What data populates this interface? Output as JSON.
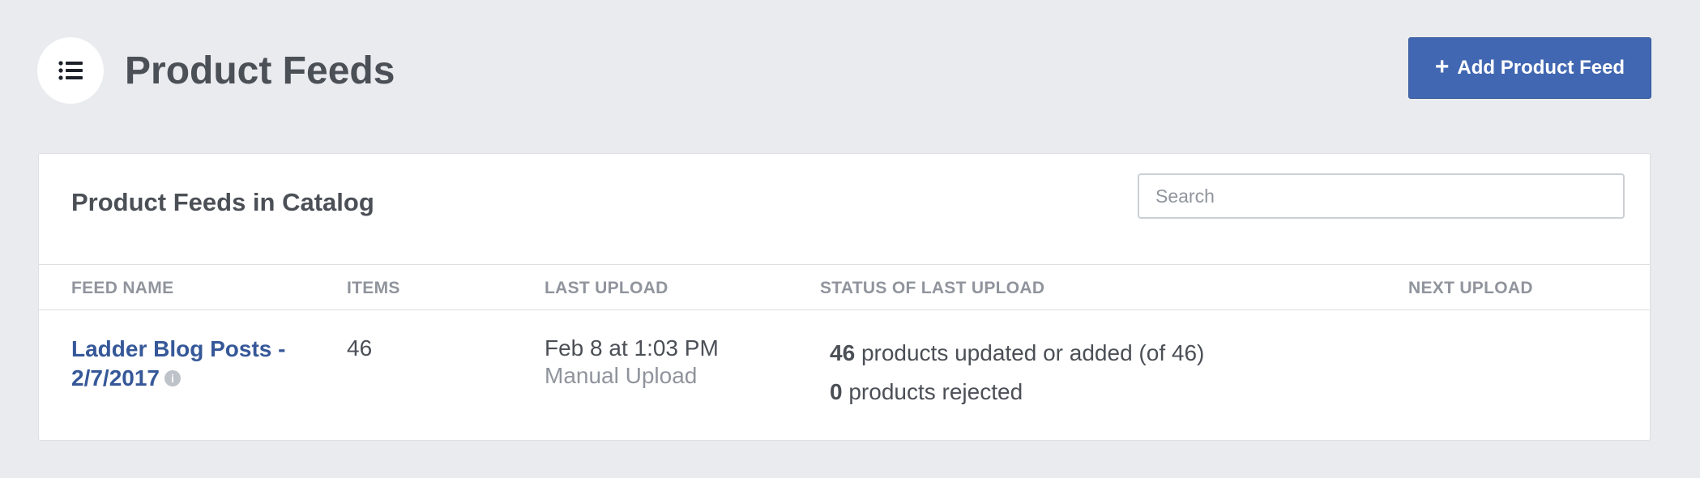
{
  "header": {
    "icon": "list-icon",
    "title": "Product Feeds",
    "add_button_plus": "+",
    "add_button_label": "Add Product Feed",
    "accent": "#4267b2"
  },
  "catalog": {
    "title": "Product Feeds in Catalog",
    "search_placeholder": "Search",
    "columns": [
      "FEED NAME",
      "ITEMS",
      "LAST UPLOAD",
      "STATUS OF LAST UPLOAD",
      "NEXT UPLOAD"
    ],
    "rows": [
      {
        "feed_name": "Ladder Blog Posts - 2/7/2017",
        "items": "46",
        "last_upload_date": "Feb 8 at 1:03 PM",
        "last_upload_method": "Manual Upload",
        "status_updated_count": "46",
        "status_updated_text": "products updated or added (of 46)",
        "status_rejected_count": "0",
        "status_rejected_text": "products rejected",
        "next_upload": ""
      }
    ]
  }
}
